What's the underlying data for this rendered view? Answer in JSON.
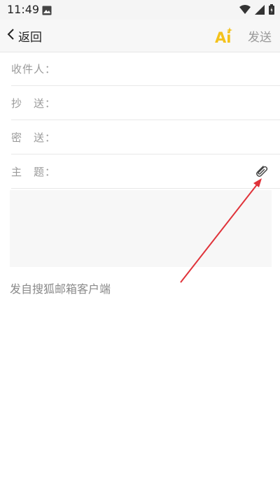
{
  "status_bar": {
    "time": "11:49",
    "icons": [
      "gallery-icon",
      "wifi-icon",
      "signal-icon",
      "battery-icon"
    ]
  },
  "header": {
    "back_label": "返回",
    "ai_label": "Ai",
    "send_label": "发送"
  },
  "fields": {
    "to_label": "收件人：",
    "to_value": "",
    "cc_label": "抄　送：",
    "cc_value": "",
    "bcc_label": "密　送：",
    "bcc_value": "",
    "subject_label": "主　题：",
    "subject_value": ""
  },
  "compose": {
    "signature": "发自搜狐邮箱客户端"
  },
  "colors": {
    "ai_accent": "#f4c21b",
    "annotation_arrow": "#e0333a",
    "send_disabled": "#999999"
  }
}
